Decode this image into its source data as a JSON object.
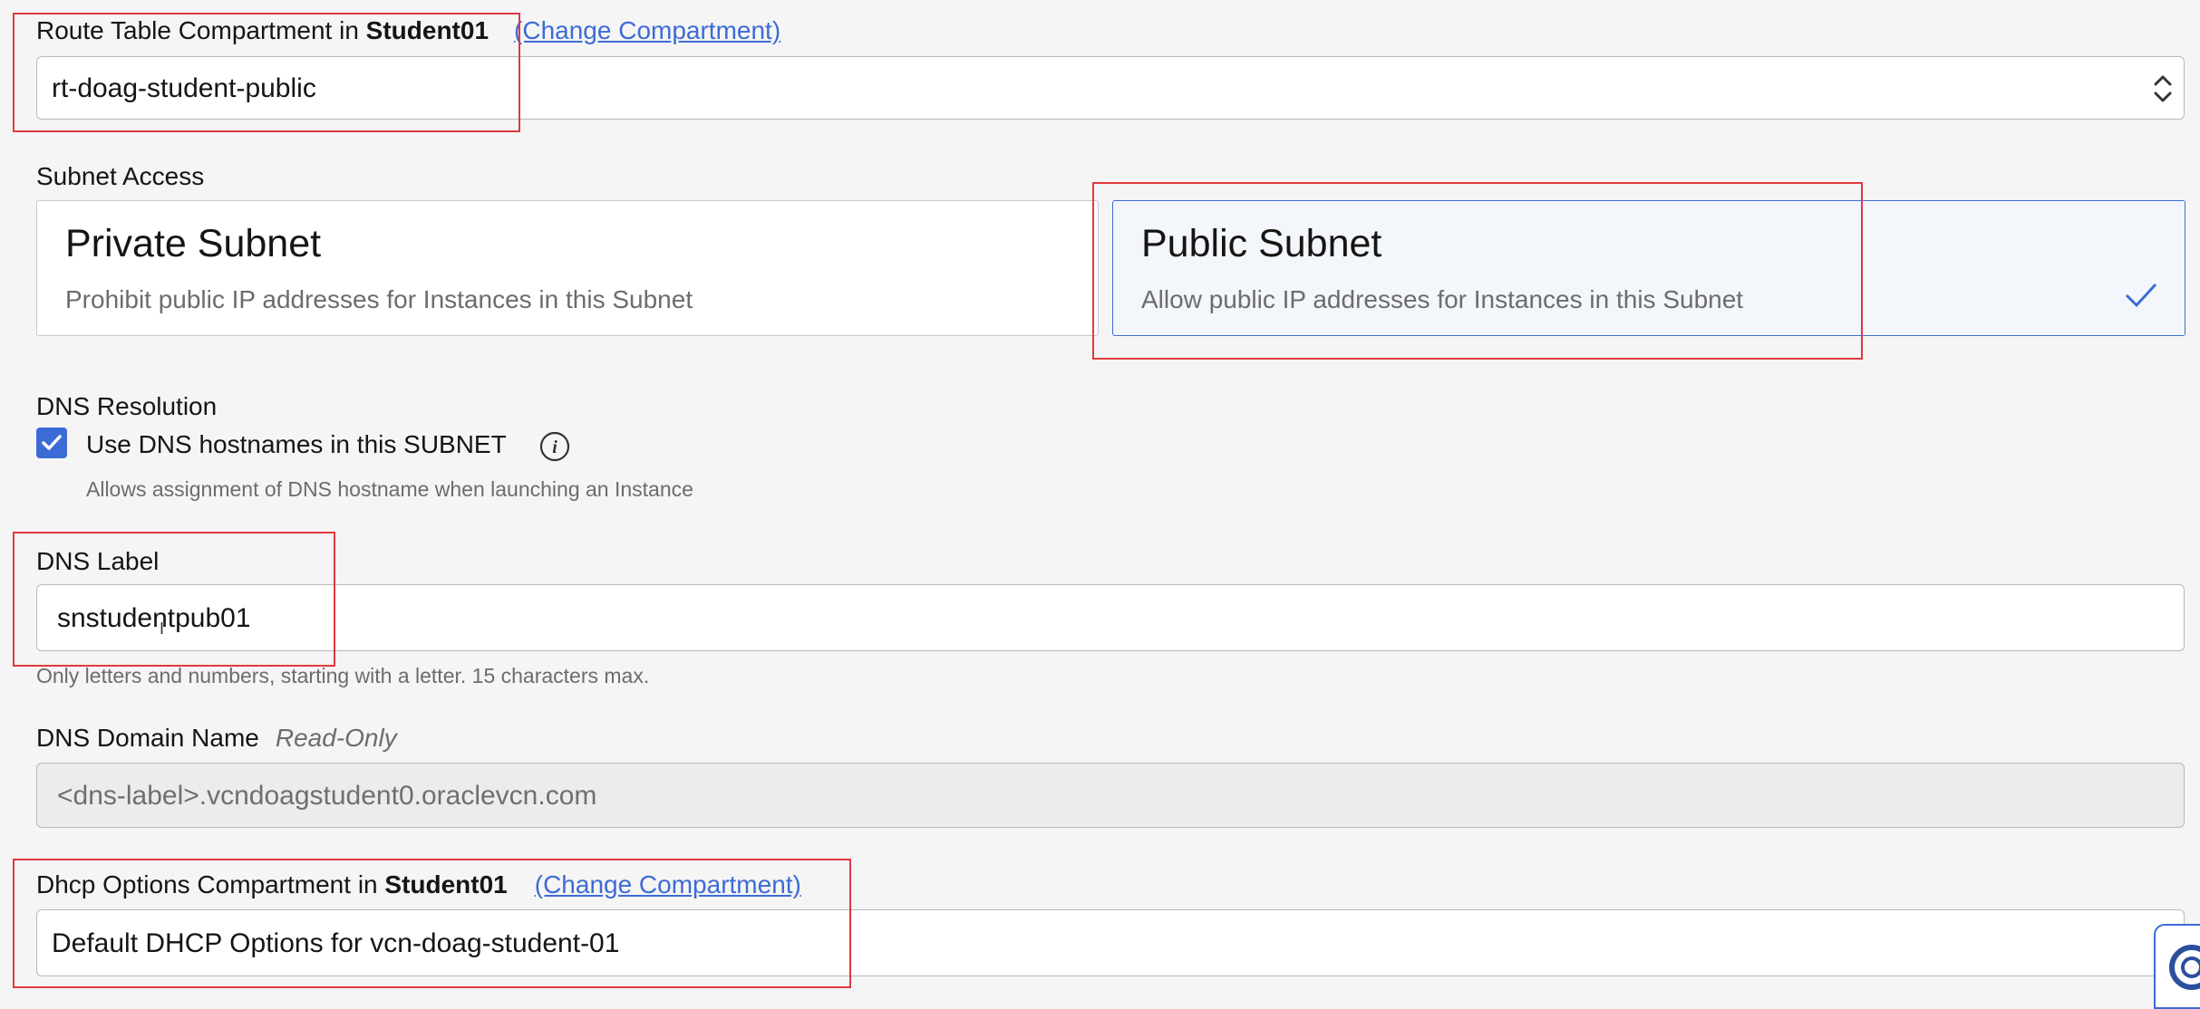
{
  "route_table": {
    "label_prefix": "Route Table Compartment in ",
    "compartment": "Student01",
    "change_link": "(Change Compartment)",
    "selected_value": "rt-doag-student-public"
  },
  "subnet_access": {
    "label": "Subnet Access",
    "private": {
      "title": "Private Subnet",
      "description": "Prohibit public IP addresses for Instances in this Subnet"
    },
    "public": {
      "title": "Public Subnet",
      "description": "Allow public IP addresses for Instances in this Subnet",
      "selected": true
    }
  },
  "dns_resolution": {
    "label": "DNS Resolution",
    "checkbox_label": "Use DNS hostnames in this SUBNET",
    "checked": true,
    "help_text": "Allows assignment of DNS hostname when launching an Instance"
  },
  "dns_label": {
    "label": "DNS Label",
    "value": "snstudentpub01",
    "hint": "Only letters and numbers, starting with a letter. 15 characters max."
  },
  "dns_domain": {
    "label": "DNS Domain Name",
    "readonly_tag": "Read-Only",
    "value": "<dns-label>.vcndoagstudent0.oraclevcn.com"
  },
  "dhcp": {
    "label_prefix": "Dhcp Options Compartment in ",
    "compartment": "Student01",
    "change_link": "(Change Compartment)",
    "selected_value": "Default DHCP Options for vcn-doag-student-01"
  },
  "icons": {
    "select_arrows": "up-down-chevron-icon",
    "check": "checkmark-icon",
    "info": "info-icon",
    "help": "lifebuoy-icon"
  },
  "colors": {
    "accent": "#3d6bd6",
    "highlight_box": "#e0393e",
    "background": "#f5f5f5"
  }
}
